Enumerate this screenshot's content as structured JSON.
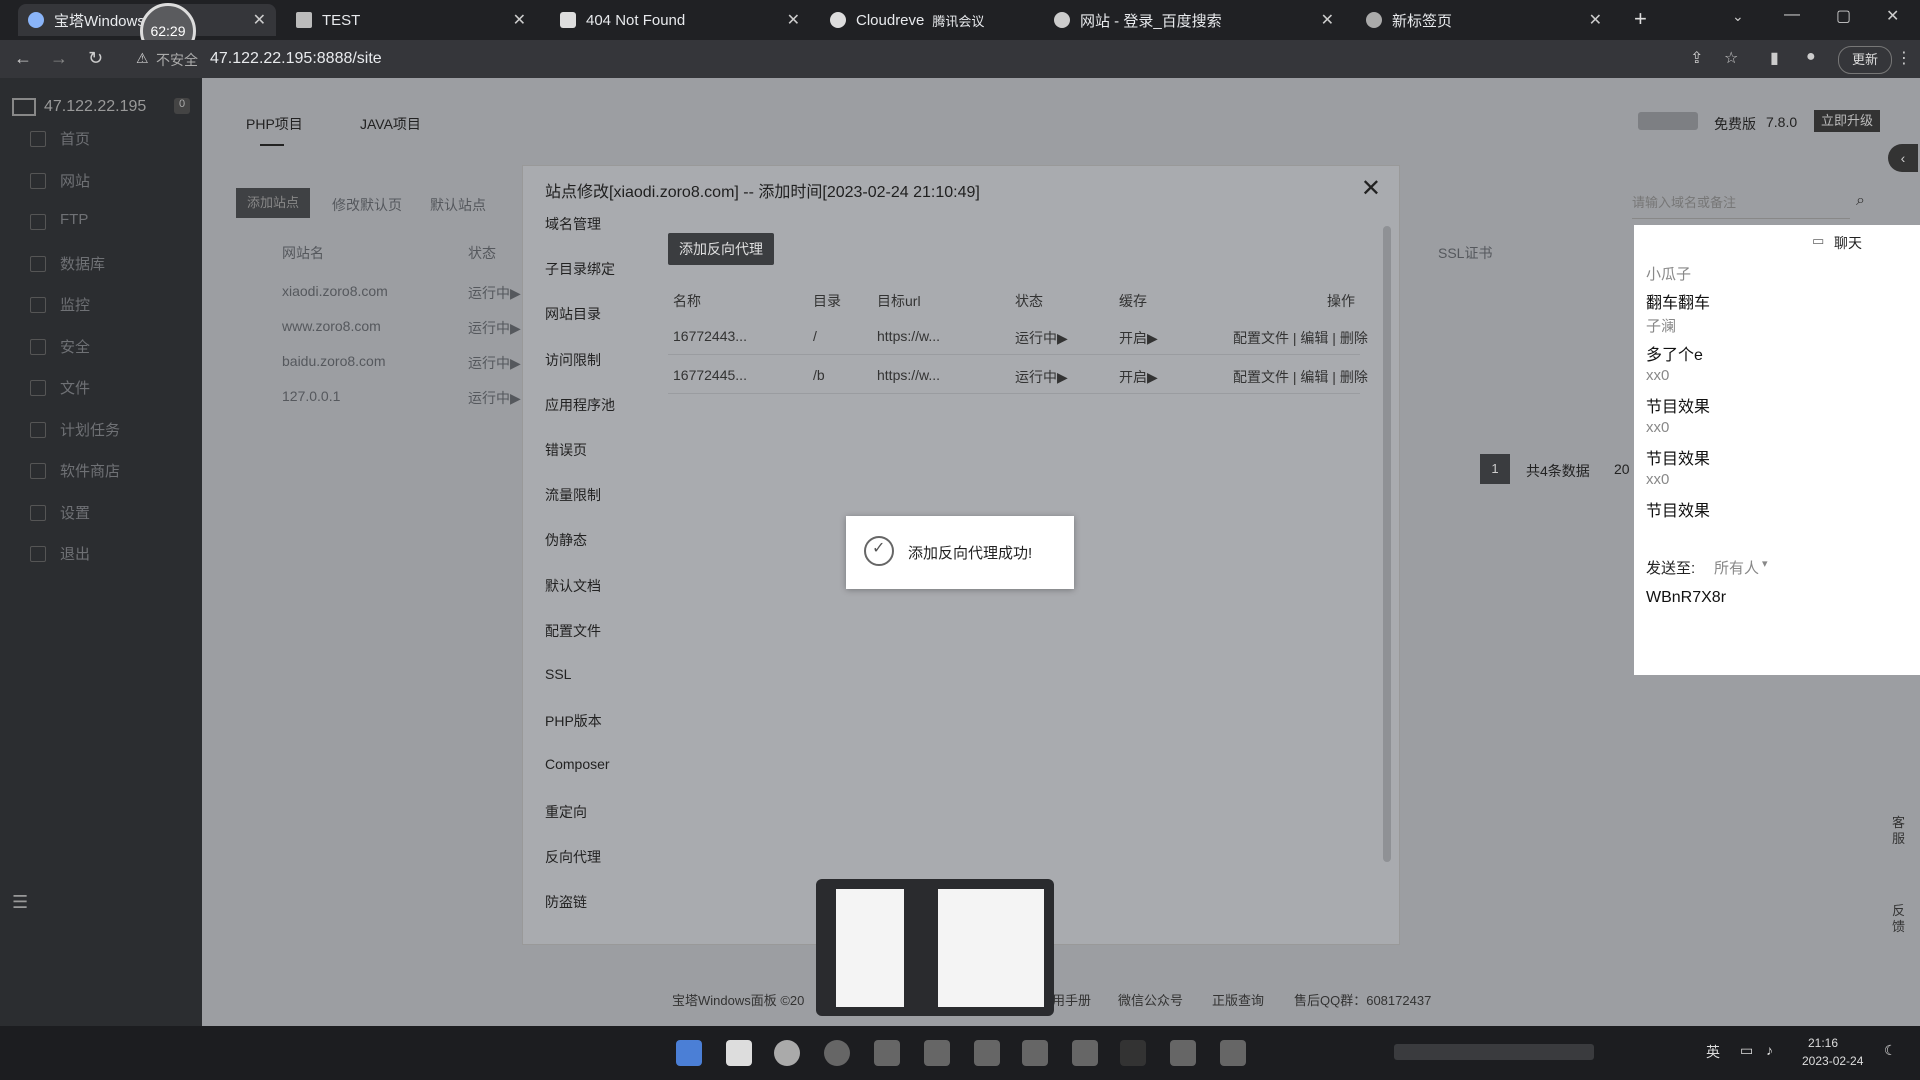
{
  "browser": {
    "tabs": [
      {
        "label": "宝塔Windows面"
      },
      {
        "label": "TEST"
      },
      {
        "label": "404 Not Found"
      },
      {
        "label": "Cloudreve"
      },
      {
        "label": "网站 - 登录_百度搜索"
      },
      {
        "label": "新标签页"
      }
    ],
    "meeting_label": "腾讯会议",
    "timer": "62:29",
    "security": "不安全",
    "url": "47.122.22.195:8888/site",
    "update_label": "更新"
  },
  "sidebar": {
    "server_ip": "47.122.22.195",
    "badge": "0",
    "items": [
      {
        "label": "首页"
      },
      {
        "label": "网站"
      },
      {
        "label": "FTP"
      },
      {
        "label": "数据库"
      },
      {
        "label": "监控"
      },
      {
        "label": "安全"
      },
      {
        "label": "文件"
      },
      {
        "label": "计划任务"
      },
      {
        "label": "软件商店"
      },
      {
        "label": "设置"
      },
      {
        "label": "退出"
      }
    ]
  },
  "main": {
    "tabs": [
      {
        "label": "PHP项目"
      },
      {
        "label": "JAVA项目"
      }
    ],
    "edition": "免费版",
    "version": "7.8.0",
    "upgrade": "立即升级",
    "toolbar": [
      "添加站点",
      "修改默认页",
      "默认站点"
    ],
    "search_placeholder": "请输入域名或备注",
    "columns": {
      "name": "网站名",
      "status": "状态",
      "ssl": "SSL证书"
    },
    "sites": [
      {
        "name": "xiaodi.zoro8.com",
        "status": "运行中▶"
      },
      {
        "name": "www.zoro8.com",
        "status": "运行中▶"
      },
      {
        "name": "baidu.zoro8.com",
        "status": "运行中▶"
      },
      {
        "name": "127.0.0.1",
        "status": "运行中▶"
      }
    ],
    "page_current": "1",
    "total": "共4条数据",
    "per_page": "20",
    "footer": "宝塔Windows面板 ©20",
    "footer_links": [
      "用手册",
      "微信公众号",
      "正版查询",
      "售后QQ群：608172437"
    ]
  },
  "dialog": {
    "title": "站点修改[xiaodi.zoro8.com] -- 添加时间[2023-02-24 21:10:49]",
    "menu": [
      "域名管理",
      "子目录绑定",
      "网站目录",
      "访问限制",
      "应用程序池",
      "错误页",
      "流量限制",
      "伪静态",
      "默认文档",
      "配置文件",
      "SSL",
      "PHP版本",
      "Composer",
      "重定向",
      "反向代理",
      "防盗链"
    ],
    "add_button": "添加反向代理",
    "headers": {
      "name": "名称",
      "dir": "目录",
      "target": "目标url",
      "status": "状态",
      "cache": "缓存",
      "ops": "操作"
    },
    "rows": [
      {
        "name": "16772443...",
        "dir": "/",
        "target": "https://w...",
        "status": "运行中▶",
        "cache": "开启▶",
        "ops": "配置文件 | 编辑 | 删除"
      },
      {
        "name": "16772445...",
        "dir": "/b",
        "target": "https://w...",
        "status": "运行中▶",
        "cache": "开启▶",
        "ops": "配置文件 | 编辑 | 删除"
      }
    ]
  },
  "toast": {
    "text": "添加反向代理成功!"
  },
  "chat": {
    "title": "聊天",
    "messages": [
      {
        "name": "小瓜子",
        "text": "翻车翻车"
      },
      {
        "name": "子澜",
        "text": "多了个e"
      },
      {
        "name": "xx0",
        "text": "节目效果"
      },
      {
        "name": "xx0",
        "text": "节目效果"
      },
      {
        "name": "xx0",
        "text": "节目效果"
      }
    ],
    "send_to_label": "发送至:",
    "send_to_value": "所有人",
    "input_value": "WBnR7X8r"
  },
  "side_widgets": [
    "客服",
    "反馈"
  ],
  "taskbar": {
    "ime": "英",
    "time": "21:16",
    "date": "2023-02-24"
  }
}
